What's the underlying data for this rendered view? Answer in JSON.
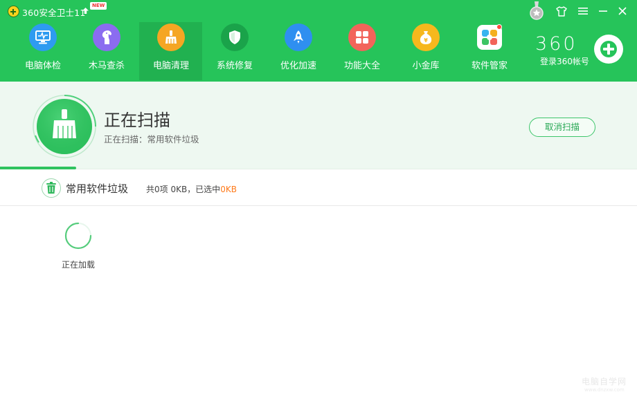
{
  "app": {
    "title": "360安全卫士11",
    "new_badge": "NEW"
  },
  "nav": {
    "items": [
      {
        "label": "电脑体检",
        "icon": "monitor-check-icon",
        "color": "#2e9bf0",
        "active": false
      },
      {
        "label": "木马查杀",
        "icon": "trojan-horse-icon",
        "color": "#8b6cf0",
        "active": false
      },
      {
        "label": "电脑清理",
        "icon": "broom-icon",
        "color": "#f5a623",
        "active": true
      },
      {
        "label": "系统修复",
        "icon": "shield-icon",
        "color": "#1aa34a",
        "active": false
      },
      {
        "label": "优化加速",
        "icon": "rocket-icon",
        "color": "#2f8ff0",
        "active": false
      },
      {
        "label": "功能大全",
        "icon": "grid-icon",
        "color": "#f2645a",
        "active": false
      },
      {
        "label": "小金库",
        "icon": "money-bag-icon",
        "color": "#f6b81d",
        "active": false
      },
      {
        "label": "软件管家",
        "icon": "software-flower-icon",
        "color": "#ffffff",
        "active": false
      }
    ]
  },
  "account": {
    "logo": "360",
    "login_label": "登录360帐号"
  },
  "scan": {
    "title": "正在扫描",
    "subtitle": "正在扫描：常用软件垃圾",
    "cancel_label": "取消扫描",
    "progress": 0.12
  },
  "category": {
    "name": "常用软件垃圾",
    "stats_prefix": "共0项 0KB，已选中",
    "stats_selected": "0KB"
  },
  "loading": {
    "text": "正在加载"
  },
  "watermark": {
    "text": "电脑自学网",
    "url": "www.dnzxw.com"
  },
  "colors": {
    "header_green": "#26c45a",
    "active_tab": "#21b150",
    "accent_orange": "#ff7a1a",
    "band_bg": "#eef8f1"
  }
}
